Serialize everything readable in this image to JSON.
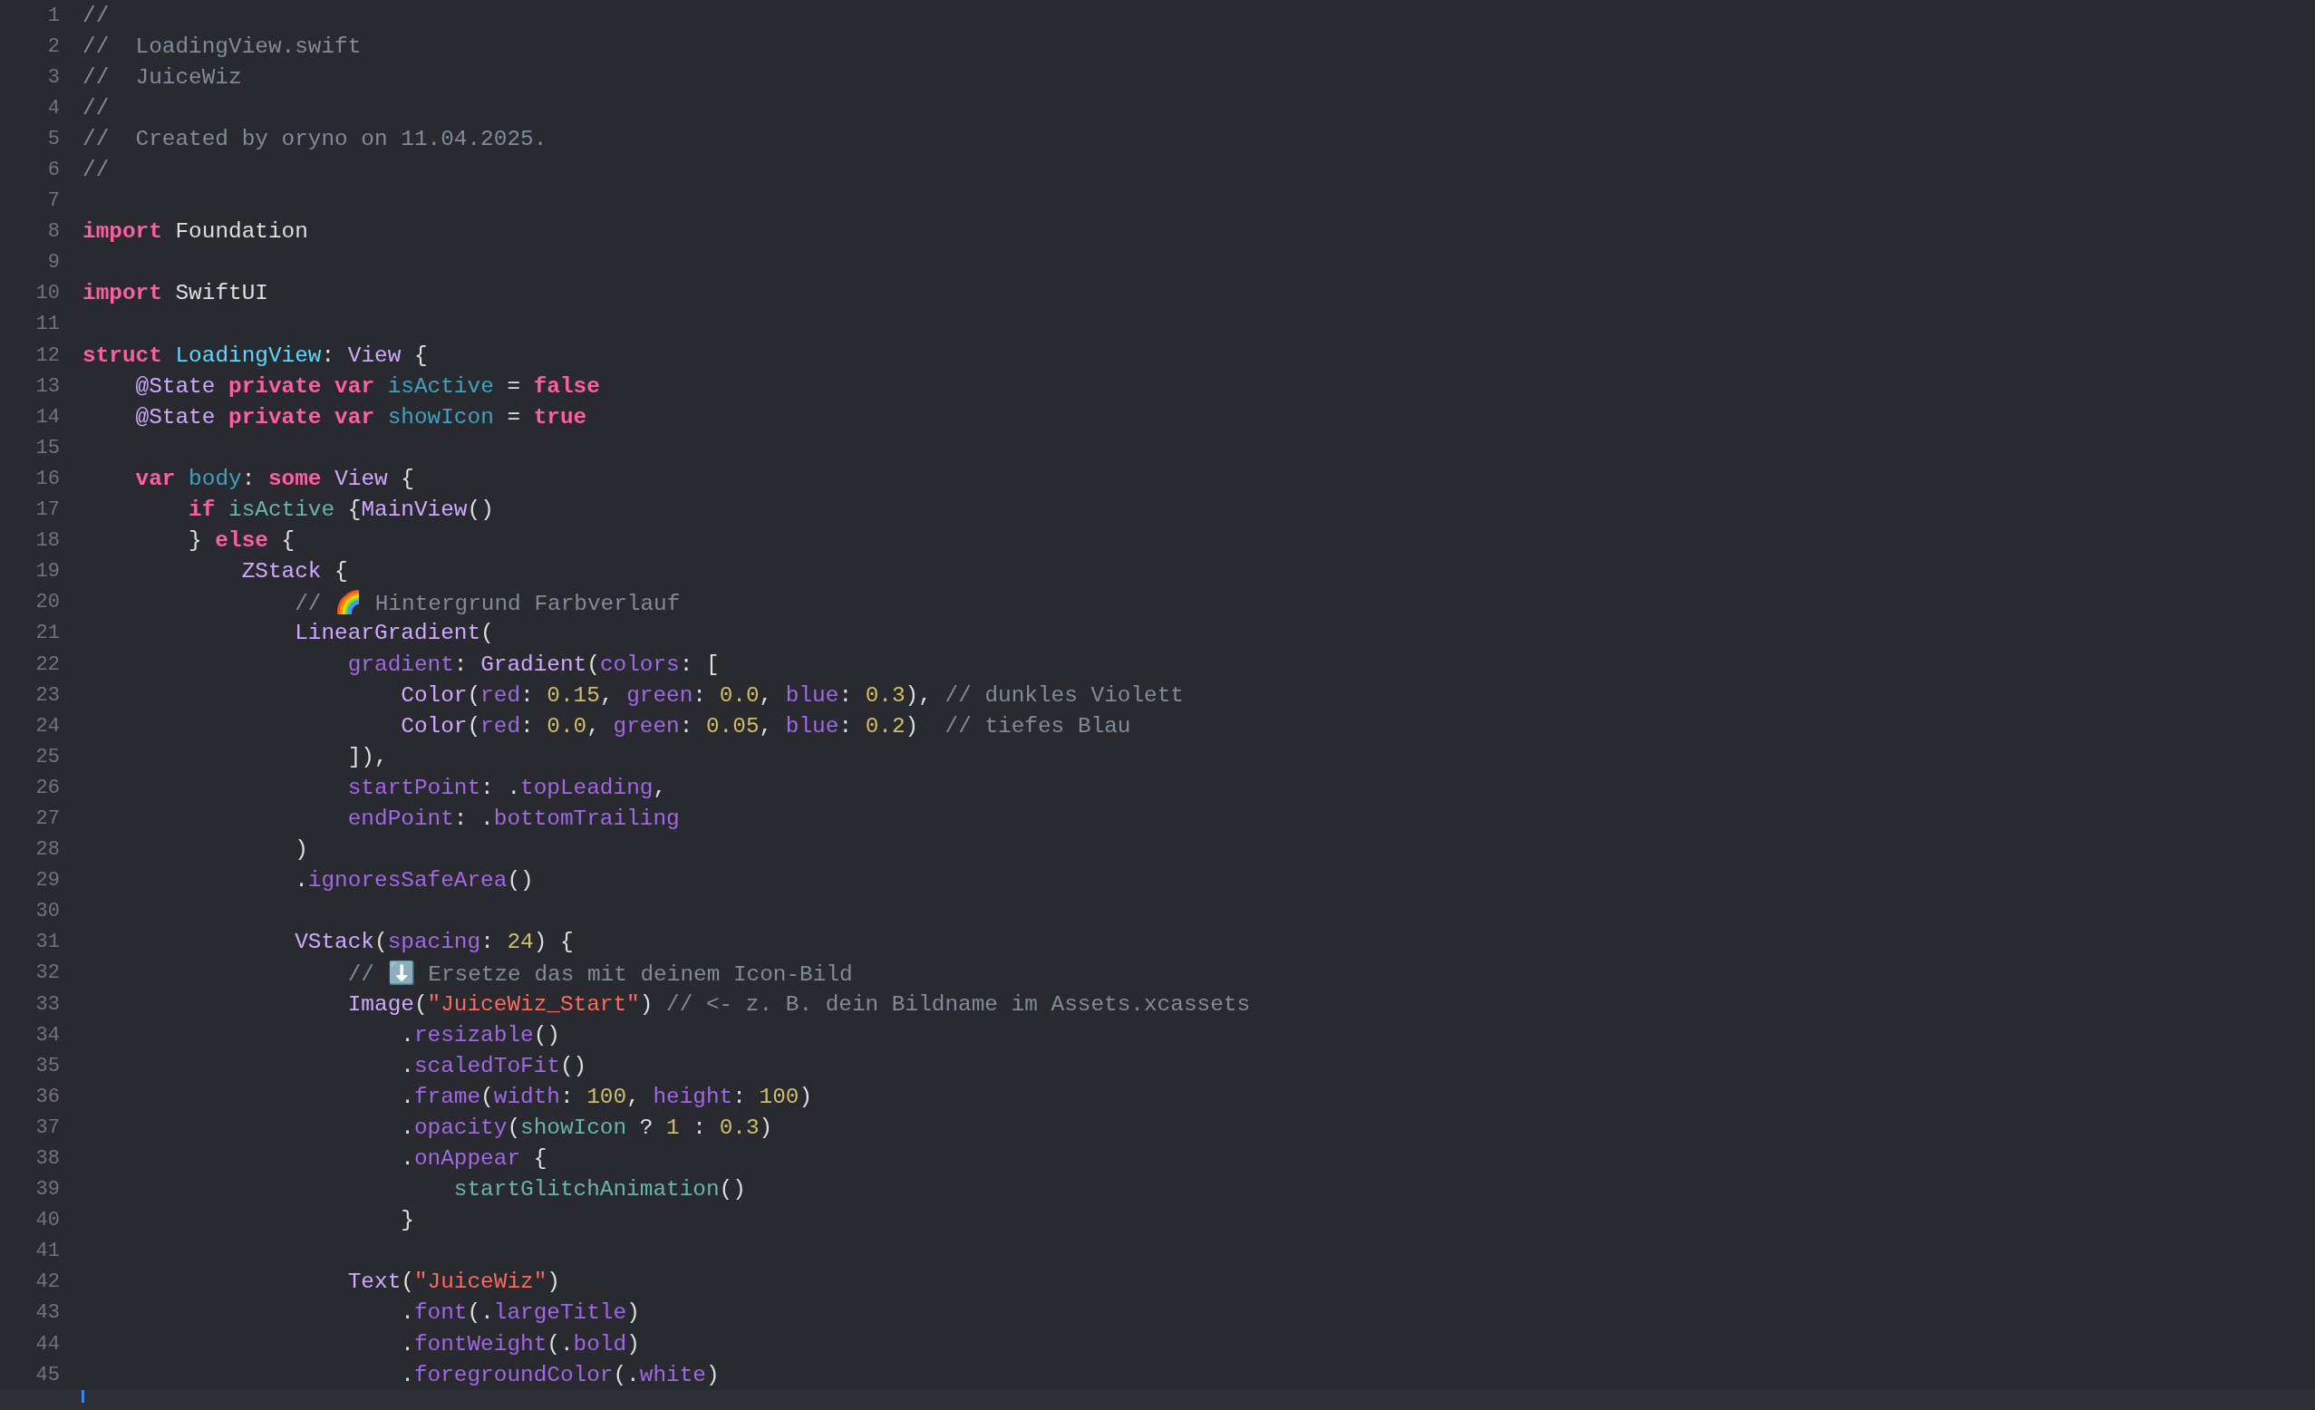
{
  "editor": {
    "lines": [
      {
        "n": "1",
        "tokens": [
          {
            "kind": "comment",
            "text": "//"
          }
        ]
      },
      {
        "n": "2",
        "tokens": [
          {
            "kind": "comment",
            "text": "//  LoadingView.swift"
          }
        ]
      },
      {
        "n": "3",
        "tokens": [
          {
            "kind": "comment",
            "text": "//  JuiceWiz"
          }
        ]
      },
      {
        "n": "4",
        "tokens": [
          {
            "kind": "comment",
            "text": "//"
          }
        ]
      },
      {
        "n": "5",
        "tokens": [
          {
            "kind": "comment",
            "text": "//  Created by oryno on 11.04.2025."
          }
        ]
      },
      {
        "n": "6",
        "tokens": [
          {
            "kind": "comment",
            "text": "//"
          }
        ]
      },
      {
        "n": "7"
      },
      {
        "n": "8",
        "tokens": [
          {
            "kind": "keyword",
            "text": "import"
          },
          {
            "kind": "plain",
            "text": " Foundation"
          }
        ]
      },
      {
        "n": "9"
      },
      {
        "n": "10",
        "tokens": [
          {
            "kind": "keyword",
            "text": "import"
          },
          {
            "kind": "plain",
            "text": " SwiftUI"
          }
        ]
      },
      {
        "n": "11"
      },
      {
        "n": "12",
        "tokens": [
          {
            "kind": "keyword",
            "text": "struct"
          },
          {
            "kind": "decl",
            "text": " LoadingView"
          },
          {
            "kind": "plain",
            "text": ": "
          },
          {
            "kind": "type",
            "text": "View"
          },
          {
            "kind": "plain",
            "text": " {"
          }
        ]
      },
      {
        "n": "13",
        "tokens": [
          {
            "kind": "type",
            "text": "    @State"
          },
          {
            "kind": "keyword",
            "text": " private"
          },
          {
            "kind": "keyword",
            "text": " var"
          },
          {
            "kind": "var",
            "text": " isActive"
          },
          {
            "kind": "plain",
            "text": " = "
          },
          {
            "kind": "keyword",
            "text": "false"
          }
        ]
      },
      {
        "n": "14",
        "tokens": [
          {
            "kind": "type",
            "text": "    @State"
          },
          {
            "kind": "keyword",
            "text": " private"
          },
          {
            "kind": "keyword",
            "text": " var"
          },
          {
            "kind": "var",
            "text": " showIcon"
          },
          {
            "kind": "plain",
            "text": " = "
          },
          {
            "kind": "keyword",
            "text": "true"
          }
        ]
      },
      {
        "n": "15"
      },
      {
        "n": "16",
        "tokens": [
          {
            "kind": "keyword",
            "text": "    var"
          },
          {
            "kind": "var",
            "text": " body"
          },
          {
            "kind": "plain",
            "text": ": "
          },
          {
            "kind": "keyword",
            "text": "some"
          },
          {
            "kind": "type",
            "text": " View"
          },
          {
            "kind": "plain",
            "text": " {"
          }
        ]
      },
      {
        "n": "17",
        "tokens": [
          {
            "kind": "keyword",
            "text": "        if"
          },
          {
            "kind": "call",
            "text": " isActive"
          },
          {
            "kind": "plain",
            "text": " {"
          },
          {
            "kind": "type",
            "text": "MainView"
          },
          {
            "kind": "plain",
            "text": "()"
          }
        ]
      },
      {
        "n": "18",
        "tokens": [
          {
            "kind": "plain",
            "text": "        }"
          },
          {
            "kind": "keyword",
            "text": " else"
          },
          {
            "kind": "plain",
            "text": " {"
          }
        ]
      },
      {
        "n": "19",
        "tokens": [
          {
            "kind": "type",
            "text": "            ZStack"
          },
          {
            "kind": "plain",
            "text": " {"
          }
        ]
      },
      {
        "n": "20",
        "tokens": [
          {
            "kind": "comment",
            "text": "                // 🌈 Hintergrund Farbverlauf"
          }
        ]
      },
      {
        "n": "21",
        "tokens": [
          {
            "kind": "type",
            "text": "                LinearGradient"
          },
          {
            "kind": "plain",
            "text": "("
          }
        ]
      },
      {
        "n": "22",
        "tokens": [
          {
            "kind": "member",
            "text": "                    gradient"
          },
          {
            "kind": "plain",
            "text": ": "
          },
          {
            "kind": "type",
            "text": "Gradient"
          },
          {
            "kind": "plain",
            "text": "("
          },
          {
            "kind": "member",
            "text": "colors"
          },
          {
            "kind": "plain",
            "text": ": ["
          }
        ]
      },
      {
        "n": "23",
        "tokens": [
          {
            "kind": "type",
            "text": "                        Color"
          },
          {
            "kind": "plain",
            "text": "("
          },
          {
            "kind": "member",
            "text": "red"
          },
          {
            "kind": "plain",
            "text": ": "
          },
          {
            "kind": "number",
            "text": "0.15"
          },
          {
            "kind": "plain",
            "text": ", "
          },
          {
            "kind": "member",
            "text": "green"
          },
          {
            "kind": "plain",
            "text": ": "
          },
          {
            "kind": "number",
            "text": "0.0"
          },
          {
            "kind": "plain",
            "text": ", "
          },
          {
            "kind": "member",
            "text": "blue"
          },
          {
            "kind": "plain",
            "text": ": "
          },
          {
            "kind": "number",
            "text": "0.3"
          },
          {
            "kind": "plain",
            "text": "), "
          },
          {
            "kind": "comment",
            "text": "// dunkles Violett"
          }
        ]
      },
      {
        "n": "24",
        "tokens": [
          {
            "kind": "type",
            "text": "                        Color"
          },
          {
            "kind": "plain",
            "text": "("
          },
          {
            "kind": "member",
            "text": "red"
          },
          {
            "kind": "plain",
            "text": ": "
          },
          {
            "kind": "number",
            "text": "0.0"
          },
          {
            "kind": "plain",
            "text": ", "
          },
          {
            "kind": "member",
            "text": "green"
          },
          {
            "kind": "plain",
            "text": ": "
          },
          {
            "kind": "number",
            "text": "0.05"
          },
          {
            "kind": "plain",
            "text": ", "
          },
          {
            "kind": "member",
            "text": "blue"
          },
          {
            "kind": "plain",
            "text": ": "
          },
          {
            "kind": "number",
            "text": "0.2"
          },
          {
            "kind": "plain",
            "text": ")  "
          },
          {
            "kind": "comment",
            "text": "// tiefes Blau"
          }
        ]
      },
      {
        "n": "25",
        "tokens": [
          {
            "kind": "plain",
            "text": "                    ]),"
          }
        ]
      },
      {
        "n": "26",
        "tokens": [
          {
            "kind": "member",
            "text": "                    startPoint"
          },
          {
            "kind": "plain",
            "text": ": ."
          },
          {
            "kind": "member",
            "text": "topLeading"
          },
          {
            "kind": "plain",
            "text": ","
          }
        ]
      },
      {
        "n": "27",
        "tokens": [
          {
            "kind": "member",
            "text": "                    endPoint"
          },
          {
            "kind": "plain",
            "text": ": ."
          },
          {
            "kind": "member",
            "text": "bottomTrailing"
          }
        ]
      },
      {
        "n": "28",
        "tokens": [
          {
            "kind": "plain",
            "text": "                )"
          }
        ]
      },
      {
        "n": "29",
        "tokens": [
          {
            "kind": "plain",
            "text": "                ."
          },
          {
            "kind": "member",
            "text": "ignoresSafeArea"
          },
          {
            "kind": "plain",
            "text": "()"
          }
        ]
      },
      {
        "n": "30"
      },
      {
        "n": "31",
        "tokens": [
          {
            "kind": "type",
            "text": "                VStack"
          },
          {
            "kind": "plain",
            "text": "("
          },
          {
            "kind": "member",
            "text": "spacing"
          },
          {
            "kind": "plain",
            "text": ": "
          },
          {
            "kind": "number",
            "text": "24"
          },
          {
            "kind": "plain",
            "text": ") {"
          }
        ]
      },
      {
        "n": "32",
        "tokens": [
          {
            "kind": "comment",
            "text": "                    // ⬇️ Ersetze das mit deinem Icon-Bild"
          }
        ]
      },
      {
        "n": "33",
        "tokens": [
          {
            "kind": "type",
            "text": "                    Image"
          },
          {
            "kind": "plain",
            "text": "("
          },
          {
            "kind": "string",
            "text": "\"JuiceWiz_Start\""
          },
          {
            "kind": "plain",
            "text": ") "
          },
          {
            "kind": "comment",
            "text": "// <- z. B. dein Bildname im Assets.xcassets"
          }
        ]
      },
      {
        "n": "34",
        "tokens": [
          {
            "kind": "plain",
            "text": "                        ."
          },
          {
            "kind": "member",
            "text": "resizable"
          },
          {
            "kind": "plain",
            "text": "()"
          }
        ]
      },
      {
        "n": "35",
        "tokens": [
          {
            "kind": "plain",
            "text": "                        ."
          },
          {
            "kind": "member",
            "text": "scaledToFit"
          },
          {
            "kind": "plain",
            "text": "()"
          }
        ]
      },
      {
        "n": "36",
        "tokens": [
          {
            "kind": "plain",
            "text": "                        ."
          },
          {
            "kind": "member",
            "text": "frame"
          },
          {
            "kind": "plain",
            "text": "("
          },
          {
            "kind": "member",
            "text": "width"
          },
          {
            "kind": "plain",
            "text": ": "
          },
          {
            "kind": "number",
            "text": "100"
          },
          {
            "kind": "plain",
            "text": ", "
          },
          {
            "kind": "member",
            "text": "height"
          },
          {
            "kind": "plain",
            "text": ": "
          },
          {
            "kind": "number",
            "text": "100"
          },
          {
            "kind": "plain",
            "text": ")"
          }
        ]
      },
      {
        "n": "37",
        "tokens": [
          {
            "kind": "plain",
            "text": "                        ."
          },
          {
            "kind": "member",
            "text": "opacity"
          },
          {
            "kind": "plain",
            "text": "("
          },
          {
            "kind": "call",
            "text": "showIcon"
          },
          {
            "kind": "plain",
            "text": " ? "
          },
          {
            "kind": "number",
            "text": "1"
          },
          {
            "kind": "plain",
            "text": " : "
          },
          {
            "kind": "number",
            "text": "0.3"
          },
          {
            "kind": "plain",
            "text": ")"
          }
        ]
      },
      {
        "n": "38",
        "tokens": [
          {
            "kind": "plain",
            "text": "                        ."
          },
          {
            "kind": "member",
            "text": "onAppear"
          },
          {
            "kind": "plain",
            "text": " {"
          }
        ]
      },
      {
        "n": "39",
        "tokens": [
          {
            "kind": "call",
            "text": "                            startGlitchAnimation"
          },
          {
            "kind": "plain",
            "text": "()"
          }
        ]
      },
      {
        "n": "40",
        "tokens": [
          {
            "kind": "plain",
            "text": "                        }"
          }
        ]
      },
      {
        "n": "41"
      },
      {
        "n": "42",
        "tokens": [
          {
            "kind": "type",
            "text": "                    Text"
          },
          {
            "kind": "plain",
            "text": "("
          },
          {
            "kind": "string",
            "text": "\"JuiceWiz\""
          },
          {
            "kind": "plain",
            "text": ")"
          }
        ]
      },
      {
        "n": "43",
        "tokens": [
          {
            "kind": "plain",
            "text": "                        ."
          },
          {
            "kind": "member",
            "text": "font"
          },
          {
            "kind": "plain",
            "text": "(."
          },
          {
            "kind": "member",
            "text": "largeTitle"
          },
          {
            "kind": "plain",
            "text": ")"
          }
        ]
      },
      {
        "n": "44",
        "tokens": [
          {
            "kind": "plain",
            "text": "                        ."
          },
          {
            "kind": "member",
            "text": "fontWeight"
          },
          {
            "kind": "plain",
            "text": "(."
          },
          {
            "kind": "member",
            "text": "bold"
          },
          {
            "kind": "plain",
            "text": ")"
          }
        ]
      },
      {
        "n": "45",
        "tokens": [
          {
            "kind": "plain",
            "text": "                        ."
          },
          {
            "kind": "member",
            "text": "foregroundColor"
          },
          {
            "kind": "plain",
            "text": "(."
          },
          {
            "kind": "member",
            "text": "white"
          },
          {
            "kind": "plain",
            "text": ")"
          }
        ]
      }
    ]
  }
}
